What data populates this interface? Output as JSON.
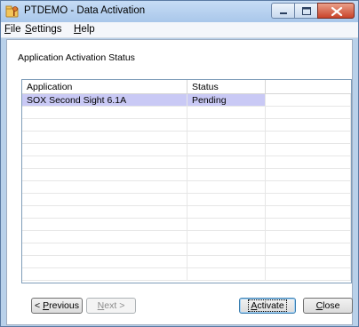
{
  "window": {
    "title": "PTDEMO - Data Activation"
  },
  "menu": {
    "items": [
      {
        "mnemonic": "F",
        "rest": "ile"
      },
      {
        "mnemonic": "S",
        "rest": "ettings"
      },
      {
        "mnemonic": "H",
        "rest": "elp"
      }
    ]
  },
  "section": {
    "label": "Application Activation Status"
  },
  "grid": {
    "columns": [
      "Application",
      "Status",
      ""
    ],
    "rows": [
      {
        "application": "SOX Second Sight 6.1A",
        "status": "Pending",
        "selected": true
      }
    ],
    "empty_rows": 14
  },
  "buttons": {
    "previous": {
      "prefix": "< ",
      "mnemonic": "P",
      "rest": "revious"
    },
    "next": {
      "mnemonic": "N",
      "rest": "ext >"
    },
    "activate": {
      "mnemonic": "A",
      "rest": "ctivate"
    },
    "close": {
      "mnemonic": "C",
      "rest": "lose"
    }
  },
  "icons": {
    "app": "folder-key-icon",
    "minimize": "minimize-icon",
    "maximize": "maximize-icon",
    "close": "close-icon"
  },
  "colors": {
    "selected_row": "#c9c9f5",
    "close_button": "#c9432a"
  }
}
